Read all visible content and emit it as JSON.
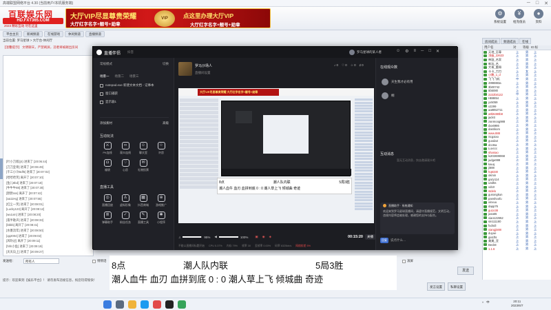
{
  "host": {
    "title": "高端联盟网络平台 4.30 (当前用户/本机服务端)",
    "logo": {
      "main": "百联娱乐网",
      "site": "HD.FXT365.COM",
      "slogan": "2023 精彩互动 尽在这里"
    },
    "ad": {
      "line1": "大厅VIP尽显尊贵荣耀",
      "line2": "大厅红字名字+靓号+勋章",
      "badge": "VIP",
      "right1": "点这里办理大厅VIP",
      "right2": "大厅红字名字+靓号+勋章"
    },
    "tools": [
      {
        "icon": "gear",
        "label": "系统设置"
      },
      {
        "icon": "recharge",
        "label": "给充值员"
      },
      {
        "icon": "account",
        "label": "资料"
      }
    ],
    "nav": [
      "平台主页",
      "新闻频道",
      "在线游戏",
      "休闲频道",
      "直播频道"
    ],
    "right_tabs": [
      "房间成员",
      "频道成员",
      "在线"
    ],
    "address": "当前位置: 罗马星球 > 大厅台-休闲厅",
    "notice": "【温馨提示】 文明聊天，严禁刷屏，违者将被踢出房间",
    "chat_log": [
      "[叶小刀叙](4) 进来了 [20:06:44]",
      "[刀刀亚骨] 进来了 [20:06:49]",
      "[千三小冷Bdf6] 进来了 [20:07:02]",
      "[哈哈哈笑] 离开了 [20:07:10]",
      "[鱼儿8bd] 进来了 [20:07:18]",
      "[牛牛牛88] 进来了 [20:07:30]",
      "[默默sss] 离开了 [20:07:42]",
      "[aa11Hg] 进来了 [20:07:55]",
      "[红尘一笑] 进来了 [20:08:01]",
      "[Lucky123] 离开了 [20:08:12]",
      "[wu1xin] 进来了 [20:08:20]",
      "[夜半歌声] 进来了 [20:08:33]",
      "[bbbb] 离开了 [20:08:41]",
      "[水墨流年] 进来了 [20:08:50]",
      "[qq2004] 进来了 [20:09:02]",
      "[风吹过] 离开了 [20:09:11]",
      "[hhh小鱼] 进来了 [20:09:19]",
      "[天天向上] 进来了 [20:09:27]"
    ],
    "user_head": [
      "用户名",
      "对",
      "等级",
      "ID:标"
    ],
    "users": [
      [
        "天地_至尊",
        "上",
        "男",
        "上"
      ],
      [
        "顶级_22623",
        "上",
        "男",
        "上"
      ],
      [
        "神鼓_名家",
        "上",
        "男",
        "上"
      ],
      [
        "新玩_名",
        "上",
        "男",
        "上"
      ],
      [
        "大哥_雷哥",
        "上",
        "男",
        "上"
      ],
      [
        "卡卡_刀刀",
        "上",
        "女",
        "上"
      ],
      [
        "小鹏_1_d",
        "上",
        "男",
        "上"
      ],
      [
        "飞飞飞机",
        "中",
        "男",
        "上"
      ],
      [
        "4998883a",
        "上",
        "男",
        "上"
      ],
      [
        "3b00742",
        "上",
        "男",
        "上"
      ],
      [
        "5b5080",
        "上",
        "男",
        "上"
      ],
      [
        "2222b0122",
        "中",
        "男",
        "上"
      ],
      [
        "HB8854",
        "上",
        "男",
        "上"
      ],
      [
        "yx5059",
        "上",
        "男",
        "上"
      ],
      [
        "x2299",
        "上",
        "男",
        "上"
      ],
      [
        "aa8852711",
        "上",
        "男",
        "上"
      ],
      [
        "a8b5380b8",
        "上",
        "男",
        "上"
      ],
      [
        "jacktt",
        "上",
        "男",
        "上"
      ],
      [
        "zanmoog988",
        "上",
        "男",
        "上"
      ],
      [
        "dxx6986",
        "上",
        "男",
        "上"
      ],
      [
        "dasrikom",
        "上",
        "男",
        "上"
      ],
      [
        "www.888",
        "上",
        "男",
        "上"
      ],
      [
        "Scgxiao",
        "上",
        "男",
        "上"
      ],
      [
        "guoda4",
        "上",
        "男",
        "上"
      ],
      [
        "dcotsa",
        "上",
        "男",
        "上"
      ],
      [
        "Luvccc",
        "上",
        "男",
        "上"
      ],
      [
        "shaniao",
        "上",
        "男",
        "上"
      ],
      [
        "lx202699068",
        "上",
        "男",
        "上"
      ],
      [
        "judge999",
        "上",
        "男",
        "上"
      ],
      [
        "kauq",
        "上",
        "男",
        "上"
      ],
      [
        "ji688",
        "上",
        "男",
        "上"
      ],
      [
        "hq6330",
        "上",
        "男",
        "上"
      ],
      [
        "okmin",
        "上",
        "男",
        "上"
      ],
      [
        "gazy114",
        "上",
        "男",
        "上"
      ],
      [
        "u4d5s",
        "上",
        "男",
        "上"
      ],
      [
        "vd10",
        "上",
        "男",
        "上"
      ],
      [
        "stdelo",
        "上",
        "男",
        "上"
      ],
      [
        "gusongkun",
        "上",
        "男",
        "上"
      ],
      [
        "panshoofu",
        "上",
        "男",
        "上"
      ],
      [
        "xinxuu",
        "上",
        "男",
        "上"
      ],
      [
        "dapp76",
        "上",
        "男",
        "上"
      ],
      [
        "gu1n38",
        "上",
        "男",
        "上"
      ],
      [
        "jusa65",
        "上",
        "男",
        "上"
      ],
      [
        "xiao122652",
        "上",
        "男",
        "上"
      ],
      [
        "sin111180",
        "上",
        "男",
        "上"
      ],
      [
        "fudodi",
        "上",
        "男",
        "上"
      ],
      [
        "xiangjin88",
        "上",
        "男",
        "上"
      ],
      [
        "duyue",
        "上",
        "男",
        "上"
      ],
      [
        "gia1fts",
        "上",
        "男",
        "上"
      ],
      [
        "美美_亚",
        "上",
        "男",
        "上"
      ],
      [
        "Beck8",
        "上",
        "男",
        "上"
      ],
      [
        "1.1.6",
        "上",
        "男",
        "上"
      ]
    ],
    "input_row": {
      "to_label": "发送给：",
      "target": "所有人",
      "cb1": "悄悄话",
      "cb2": "滚屏"
    },
    "send_label": "发送",
    "hint": "提示：欢迎来到【娱乐平台】！ 请勿发布违规信息，祝您玩得愉快！",
    "bottom_buttons": [
      "发言设置",
      "私聊设置"
    ]
  },
  "stream": {
    "app_name": "直播伴侣",
    "app_sub": "抖音",
    "account": "罗马星球的某人者",
    "title_controls": [
      "☺",
      "⚙",
      "≡",
      "─",
      "□",
      "✕"
    ],
    "mode_label": "常规模式",
    "mode_action": "切换",
    "scene_tabs": [
      "场景一",
      "场景二",
      "场景三"
    ],
    "sources": [
      "notepad.exe 新建文本文档 - 记事本",
      "窗口捕获",
      "显示器1"
    ],
    "add_source": "添加素材",
    "add_source_extra": "高级",
    "interact_title": "互动玩法",
    "interact": [
      "PK连线",
      "观众连线",
      "聊天室",
      "许愿",
      "福袋",
      "心愿",
      "礼物投票"
    ],
    "tools_title": "直播工具",
    "tools": [
      "直播回放",
      "虚拟形象",
      "抖音商城",
      "游戏推广",
      "弹幕助手",
      "粉丝任务",
      "直播工具",
      "小程序"
    ],
    "stream_title": "罗马沙场人",
    "stream_sub": "直播间设置",
    "head_stats": [
      "♪ 0",
      "♡ 0",
      "☆ 0",
      "♯ 0"
    ],
    "preview_ad": "大厅VIP尽显尊贵荣耀 大厅红字名字+靓号+勋章",
    "overlay_r1": [
      "8点",
      "潮人队内联",
      "5局3胜"
    ],
    "overlay_r2": "潮人血牛 血刃 血拼到底 0 : 0 潮人草上飞 倾城曲 奇迹",
    "mic_volume": 95,
    "speaker_volume": 100,
    "mic_label": "95%",
    "speaker_label": "100%",
    "timer": "00:15:20",
    "stop_label": "关播",
    "status": [
      "不能以直播间标题开始",
      "CPU 5.37%",
      "内存 79%",
      "帧率 30",
      "丢帧率 0.00%",
      "码率 6325kb/s",
      "延迟 28ms"
    ],
    "status_red": "网络较差 5%",
    "viewers_title": "在线观众数",
    "viewers": [
      "天生我才必有用",
      "桐"
    ],
    "chat_title": "互动消息",
    "chat_empty": "暂无互动消息，快去邀请观众吧",
    "notice_head": "直播助手 · 系统通知",
    "notice_body": "欢迎来到罗马星球直播间，请遵守直播规范，文明互动，违规内容将会被处理，感谢您的支持与配合。",
    "input_pill": "回复",
    "input_placeholder": "说点什么…"
  },
  "subtitle": {
    "r1": [
      "8点",
      "潮人队内联",
      "5局3胜"
    ],
    "r2": "潮人血牛 血刃 血拼到底 0 :  0 潮人草上飞 倾城曲 奇迹"
  },
  "taskbar": {
    "time": "20:11",
    "date": "2023/6/7",
    "ime": "中",
    "tray": [
      "^",
      "英"
    ]
  }
}
